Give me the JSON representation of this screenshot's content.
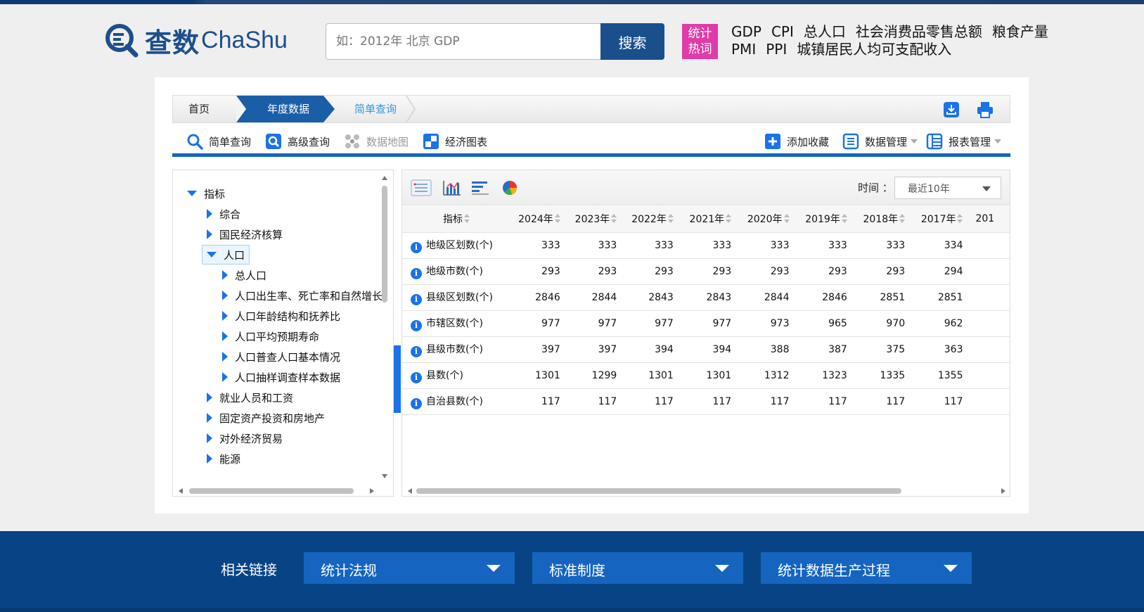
{
  "header": {
    "logo_cn": "查数",
    "logo_en": "ChaShu",
    "search_placeholder": "如：2012年 北京 GDP",
    "search_button": "搜索",
    "hot_badge_line1": "统计",
    "hot_badge_line2": "热词",
    "hot_words": [
      "GDP",
      "CPI",
      "总人口",
      "社会消费品零售总额",
      "粮食产量",
      "PMI",
      "PPI",
      "城镇居民人均可支配收入"
    ]
  },
  "breadcrumb": {
    "home": "首页",
    "annual": "年度数据",
    "current": "简单查询"
  },
  "toolbar": {
    "simple_query": "简单查询",
    "advanced_query": "高级查询",
    "data_map": "数据地图",
    "economic_chart": "经济图表",
    "add_favorite": "添加收藏",
    "data_manage": "数据管理",
    "report_manage": "报表管理"
  },
  "tree": {
    "root": "指标",
    "items": [
      {
        "label": "综合"
      },
      {
        "label": "国民经济核算"
      },
      {
        "label": "人口"
      },
      {
        "label": "总人口"
      },
      {
        "label": "人口出生率、死亡率和自然增长"
      },
      {
        "label": "人口年龄结构和抚养比"
      },
      {
        "label": "人口平均预期寿命"
      },
      {
        "label": "人口普查人口基本情况"
      },
      {
        "label": "人口抽样调查样本数据"
      },
      {
        "label": "就业人员和工资"
      },
      {
        "label": "固定资产投资和房地产"
      },
      {
        "label": "对外经济贸易"
      },
      {
        "label": "能源"
      }
    ]
  },
  "table_tools": {
    "time_label": "时间 ：",
    "time_value": "最近10年"
  },
  "table": {
    "header_indicator": "指标",
    "years": [
      "2024年",
      "2023年",
      "2022年",
      "2021年",
      "2020年",
      "2019年",
      "2018年",
      "2017年",
      "201"
    ],
    "rows": [
      {
        "name": "地级区划数(个)",
        "values": [
          "333",
          "333",
          "333",
          "333",
          "333",
          "333",
          "333",
          "334",
          ""
        ]
      },
      {
        "name": "地级市数(个)",
        "values": [
          "293",
          "293",
          "293",
          "293",
          "293",
          "293",
          "293",
          "294",
          ""
        ]
      },
      {
        "name": "县级区划数(个)",
        "values": [
          "2846",
          "2844",
          "2843",
          "2843",
          "2844",
          "2846",
          "2851",
          "2851",
          ""
        ]
      },
      {
        "name": "市辖区数(个)",
        "values": [
          "977",
          "977",
          "977",
          "977",
          "973",
          "965",
          "970",
          "962",
          ""
        ]
      },
      {
        "name": "县级市数(个)",
        "values": [
          "397",
          "397",
          "394",
          "394",
          "388",
          "387",
          "375",
          "363",
          ""
        ]
      },
      {
        "name": "县数(个)",
        "values": [
          "1301",
          "1299",
          "1301",
          "1301",
          "1312",
          "1323",
          "1335",
          "1355",
          ""
        ]
      },
      {
        "name": "自治县数(个)",
        "values": [
          "117",
          "117",
          "117",
          "117",
          "117",
          "117",
          "117",
          "117",
          ""
        ]
      }
    ]
  },
  "footer": {
    "label": "相关链接",
    "selects": [
      "统计法规",
      "标准制度",
      "统计数据生产过程"
    ]
  },
  "colors": {
    "brand": "#1c4f8c",
    "accent": "#1565c0",
    "hot_badge": "#e03ca8",
    "footer": "#084485"
  }
}
